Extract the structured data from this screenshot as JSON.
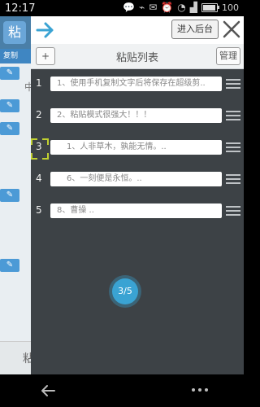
{
  "status_bar": {
    "time": "12:17",
    "battery": "100"
  },
  "background_app": {
    "logo_char": "粘",
    "tab_label": "复制",
    "side_text": "中",
    "bottom_text": "粘"
  },
  "panel": {
    "backend_button": "进入后台",
    "add_button": "+",
    "title": "粘贴列表",
    "manage_button": "管理",
    "items": [
      {
        "num": "1",
        "text": "1、使用手机复制文字后将保存在超级剪.."
      },
      {
        "num": "2",
        "text": "2、粘贴模式很强大！！！"
      },
      {
        "num": "3",
        "text": "1、人非草木，孰能无情。.."
      },
      {
        "num": "4",
        "text": "6、一刻便是永恒。.."
      },
      {
        "num": "5",
        "text": "8、曹操 .."
      }
    ],
    "page_indicator": "3/5"
  },
  "colors": {
    "accent_blue": "#3aa3d3",
    "panel_bg": "#3d4246"
  }
}
